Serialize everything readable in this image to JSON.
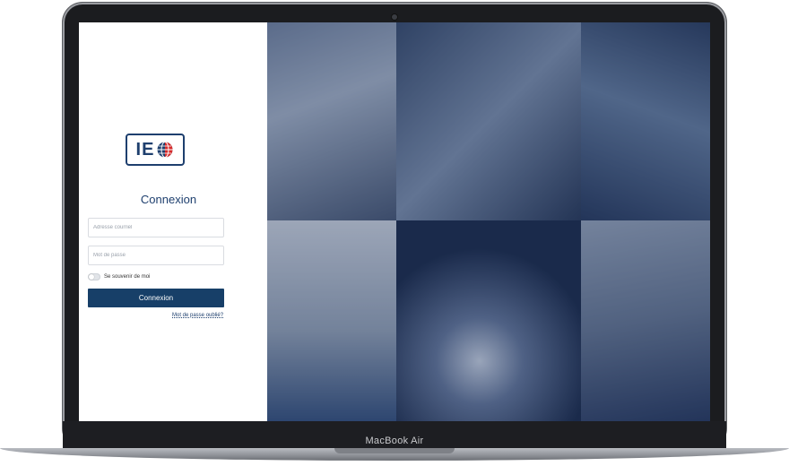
{
  "device": {
    "label": "MacBook Air"
  },
  "login": {
    "title": "Connexion",
    "email_placeholder": "Adresse courriel",
    "password_placeholder": "Mot de passe",
    "remember_label": "Se souvenir de moi",
    "submit_label": "Connexion",
    "forgot_label": "Mot de passe oublié?"
  },
  "logo": {
    "text": "IE"
  },
  "colors": {
    "brand_blue": "#173f68",
    "logo_red": "#d62b2b"
  }
}
